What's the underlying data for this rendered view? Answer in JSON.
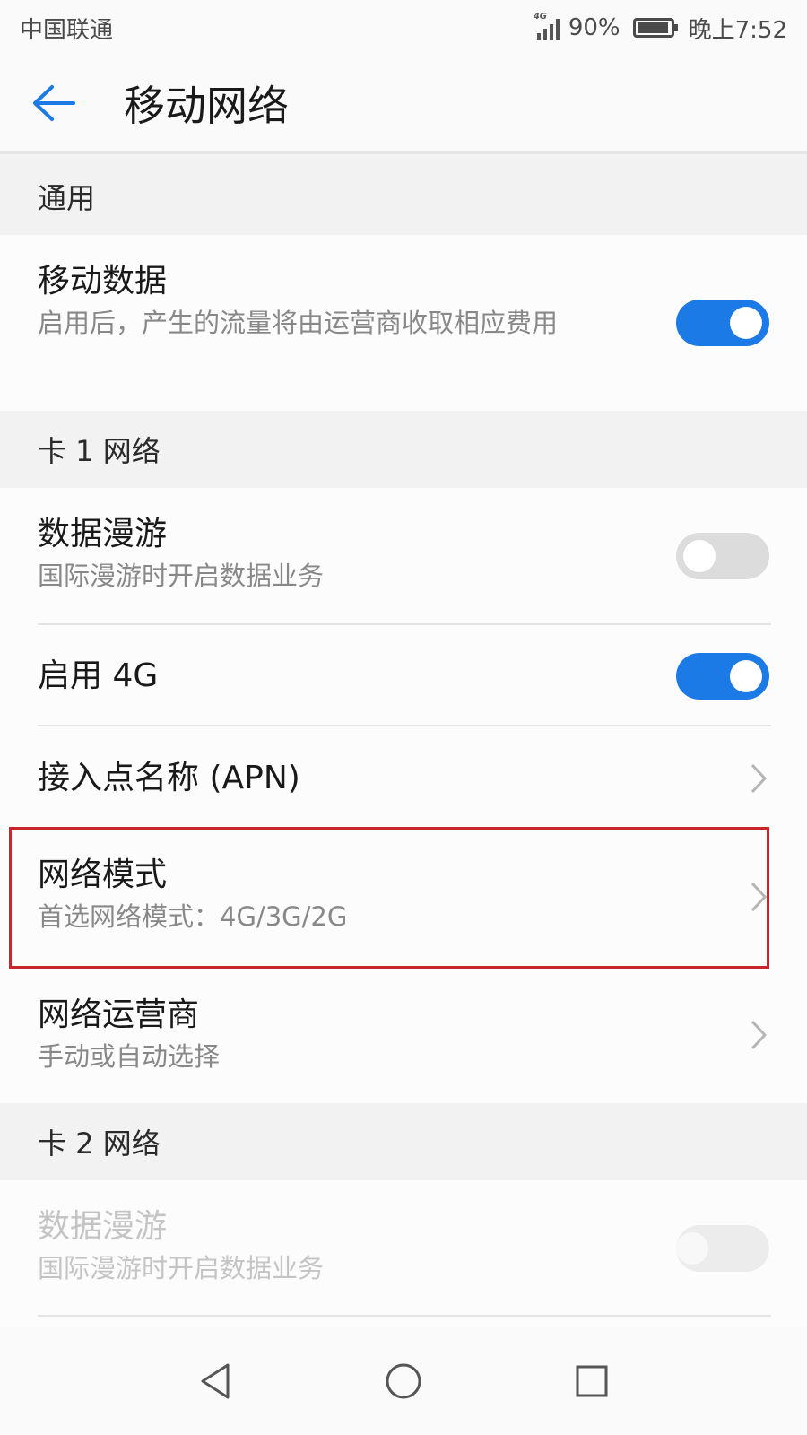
{
  "status_bar": {
    "carrier": "中国联通",
    "network_type": "4G",
    "battery": "90%",
    "time": "晚上7:52"
  },
  "header": {
    "title": "移动网络",
    "back_icon": "arrow-left-icon"
  },
  "sections": {
    "general": {
      "label": "通用",
      "mobile_data": {
        "title": "移动数据",
        "subtitle": "启用后，产生的流量将由运营商收取相应费用",
        "enabled": true
      }
    },
    "sim1": {
      "label": "卡 1 网络",
      "data_roaming": {
        "title": "数据漫游",
        "subtitle": "国际漫游时开启数据业务",
        "enabled": false
      },
      "enable_4g": {
        "title": "启用 4G",
        "enabled": true
      },
      "apn": {
        "title": "接入点名称 (APN)"
      },
      "network_mode": {
        "title": "网络模式",
        "subtitle": "首选网络模式：4G/3G/2G"
      },
      "carrier": {
        "title": "网络运营商",
        "subtitle": "手动或自动选择"
      }
    },
    "sim2": {
      "label": "卡 2 网络",
      "data_roaming": {
        "title": "数据漫游",
        "subtitle": "国际漫游时开启数据业务",
        "enabled": false,
        "disabled": true
      }
    }
  },
  "colors": {
    "accent": "#1b7ae6",
    "highlight_border": "#c7262e"
  },
  "nav_icons": [
    "back-triangle-icon",
    "home-circle-icon",
    "recents-square-icon"
  ]
}
